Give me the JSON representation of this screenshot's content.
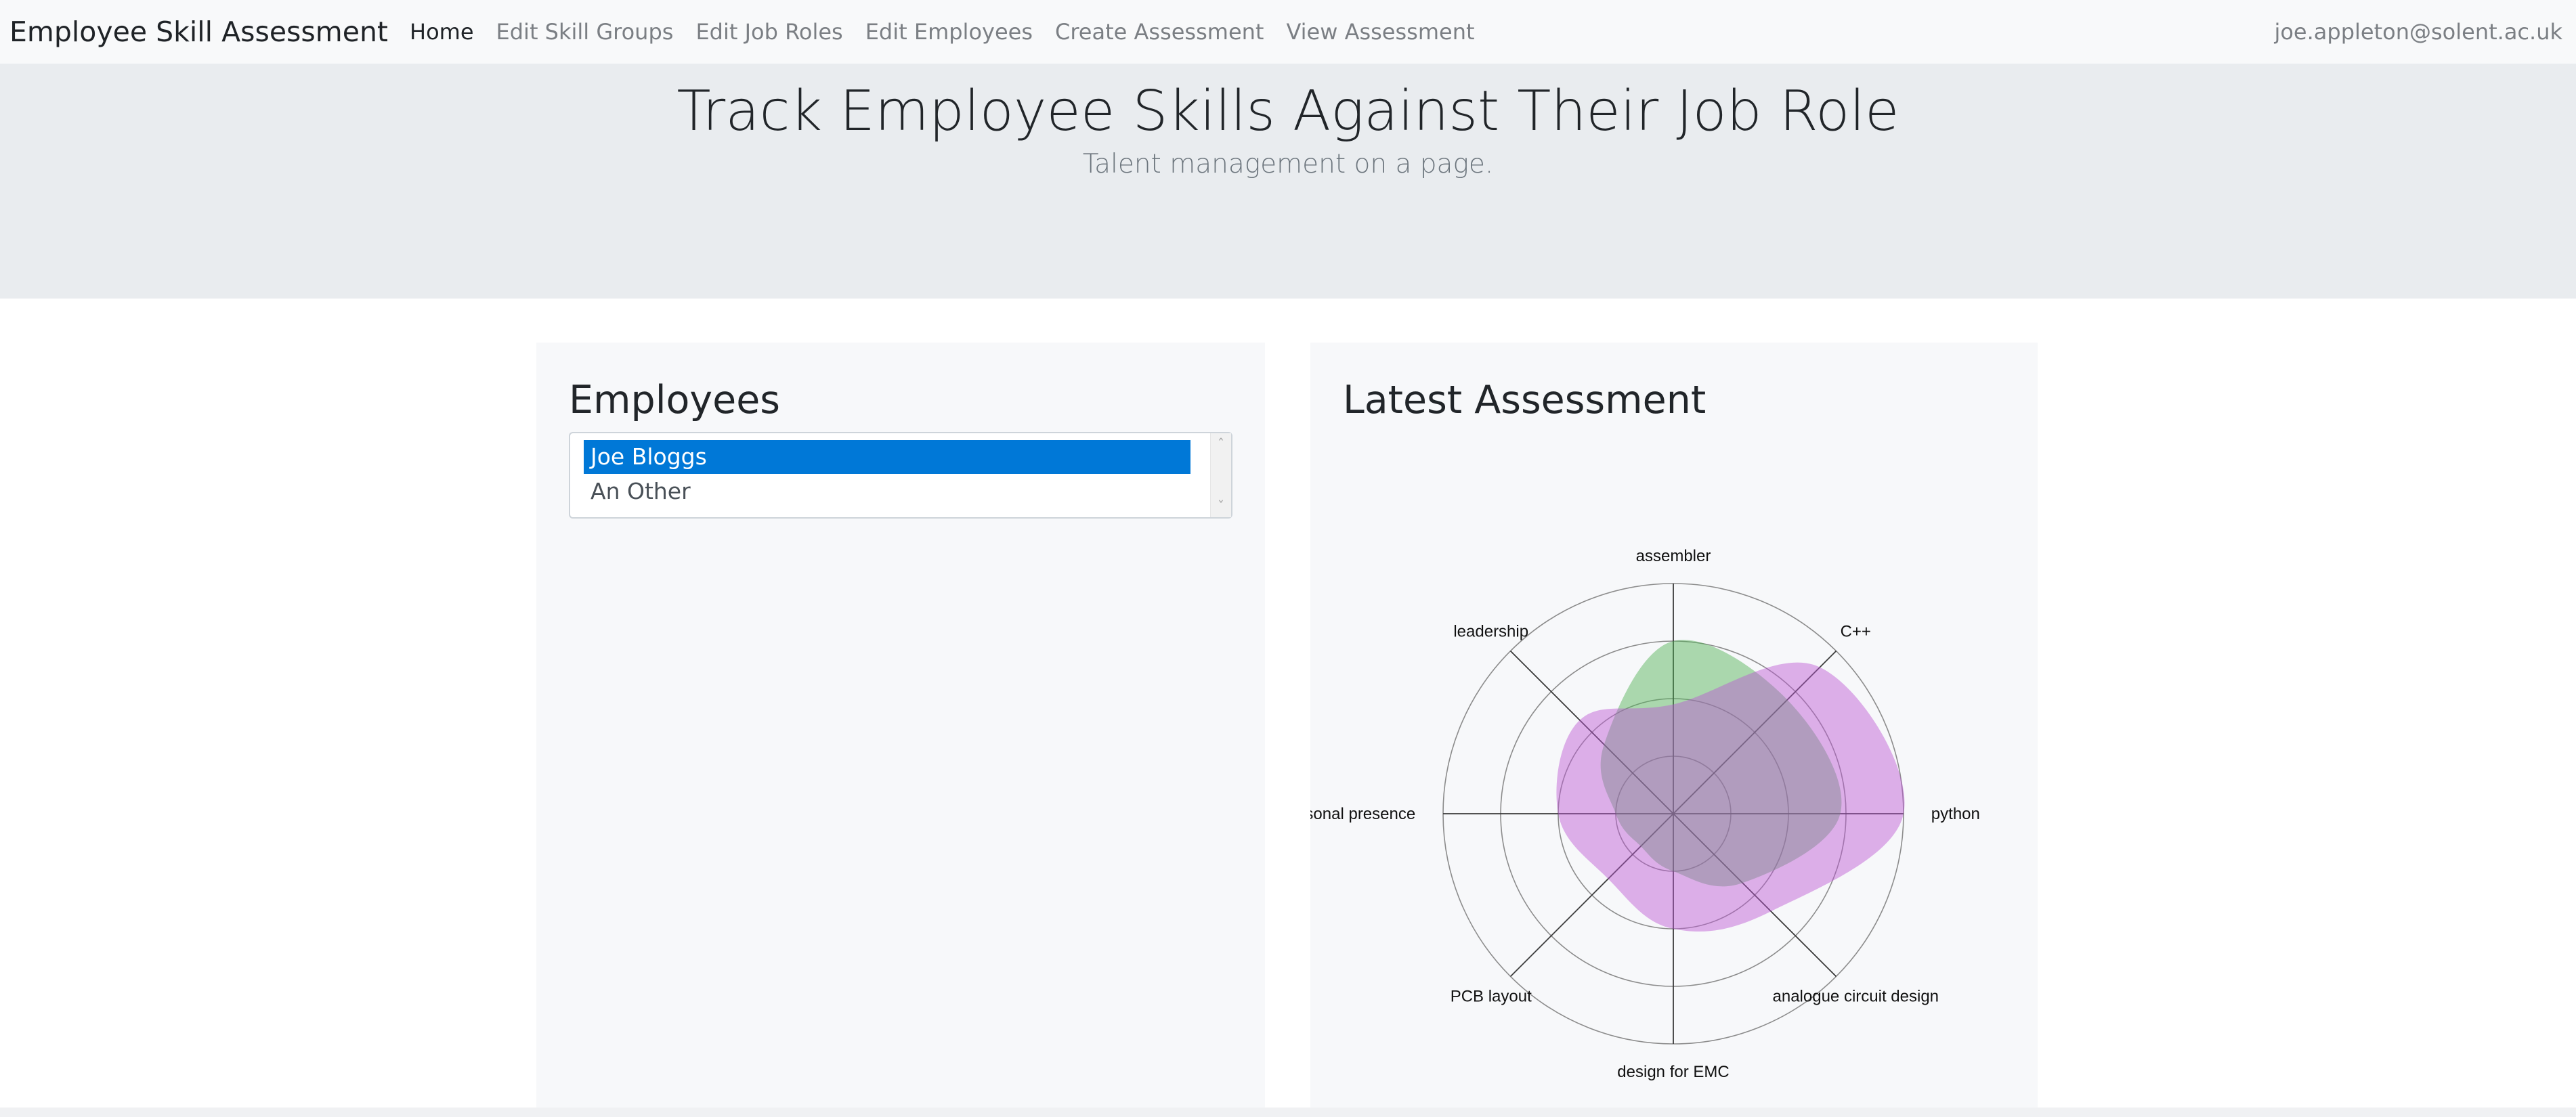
{
  "navbar": {
    "brand": "Employee Skill Assessment",
    "links": [
      "Home",
      "Edit Skill Groups",
      "Edit Job Roles",
      "Edit Employees",
      "Create Assessment",
      "View Assessment"
    ],
    "user": "joe.appleton@solent.ac.uk"
  },
  "jumbotron": {
    "title": "Track Employee Skills Against Their Job Role",
    "lead": "Talent management on a page."
  },
  "employees": {
    "heading": "Employees",
    "options": [
      "Joe Bloggs",
      "An Other"
    ],
    "selected": "Joe Bloggs"
  },
  "assessment": {
    "heading": "Latest Assessment"
  },
  "colors": {
    "selected_option": "#0078d7",
    "series_green": "#4caf50",
    "series_purple": "#ba55d3"
  },
  "chart_data": {
    "type": "radar",
    "axes": [
      "assembler",
      "C++",
      "python",
      "analogue circuit design",
      "design for EMC",
      "PCB layout",
      "personal presence",
      "leadership"
    ],
    "rlim": [
      0,
      4
    ],
    "rings": 4,
    "grid": true,
    "legend": "none",
    "series": [
      {
        "color": "#4caf50",
        "values": [
          3.0,
          2.8,
          2.9,
          1.7,
          1.0,
          0.8,
          1.0,
          1.7
        ]
      },
      {
        "color": "#ba55d3",
        "values": [
          1.9,
          3.6,
          4.0,
          2.4,
          2.0,
          1.6,
          2.0,
          2.3
        ]
      }
    ]
  }
}
